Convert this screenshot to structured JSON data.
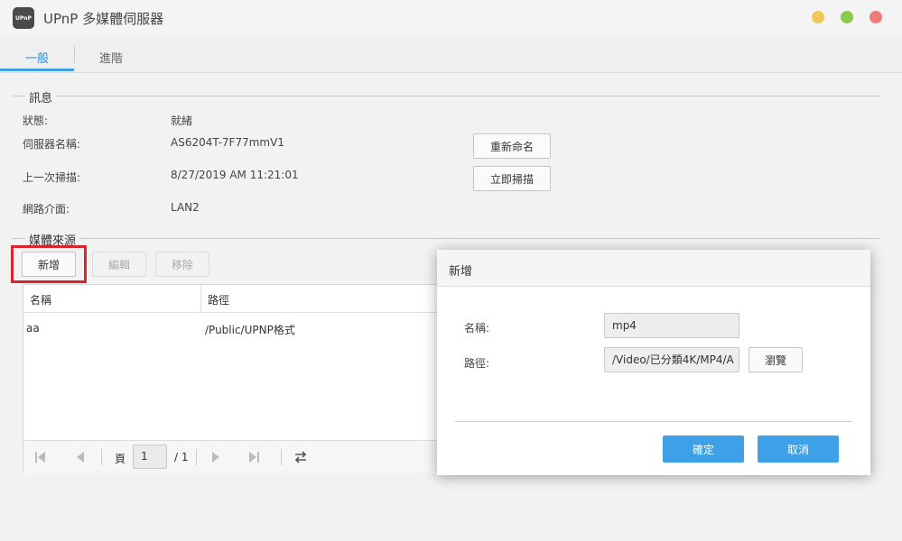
{
  "window": {
    "title": "UPnP 多媒體伺服器",
    "icon_text": "UPnP",
    "controls": {
      "minimize_color": "#f1c75a",
      "maximize_color": "#8cc84b",
      "close_color": "#f07b7b"
    }
  },
  "tabs": [
    {
      "label": "一般",
      "active": true
    },
    {
      "label": "進階",
      "active": false
    }
  ],
  "info": {
    "title": "訊息",
    "status_label": "狀態:",
    "status_value": "就緒",
    "server_name_label": "伺服器名稱:",
    "server_name_value": "AS6204T-7F77mmV1",
    "rename_button": "重新命名",
    "last_scan_label": "上一次掃描:",
    "last_scan_value": "8/27/2019 AM 11:21:01",
    "scan_now_button": "立即掃描",
    "network_label": "網路介面:",
    "network_value": "LAN2"
  },
  "media": {
    "title": "媒體來源",
    "add_button": "新增",
    "edit_button": "編輯",
    "remove_button": "移除",
    "columns": [
      "名稱",
      "路徑"
    ],
    "rows": [
      {
        "name": "aa",
        "path": "/Public/UPNP格式"
      }
    ],
    "pager": {
      "page_label": "頁",
      "page_value": "1",
      "total": "/ 1"
    }
  },
  "dialog": {
    "title": "新增",
    "name_label": "名稱:",
    "name_value": "mp4",
    "path_label": "路徑:",
    "path_value": "/Video/已分類4K/MP4/A",
    "browse_button": "瀏覽",
    "ok_button": "確定",
    "cancel_button": "取消"
  },
  "colors": {
    "accent": "#3ea0e6",
    "highlight_box": "#d9232d"
  }
}
